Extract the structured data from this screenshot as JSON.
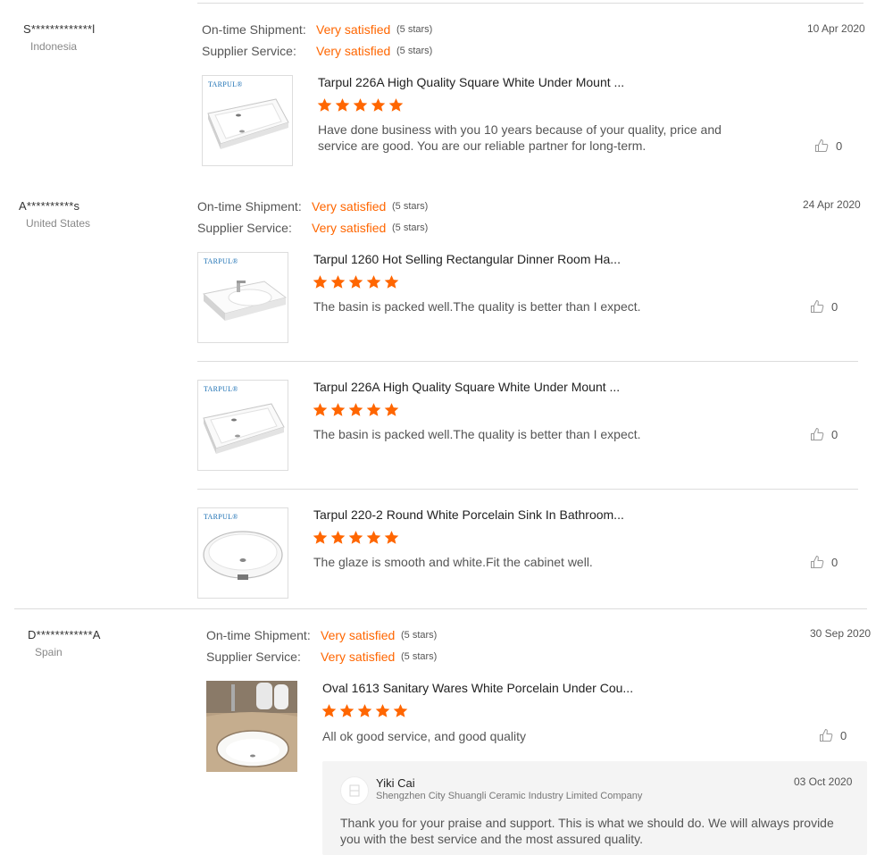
{
  "labels": {
    "ontime": "On-time Shipment:",
    "supplier": "Supplier Service:"
  },
  "colors": {
    "accent": "#ff6600"
  },
  "reviewers": [
    {
      "name": "S*************l",
      "country": "Indonesia",
      "date": "10 Apr 2020",
      "ontime": "Very satisfied",
      "ontime_stars": "(5 stars)",
      "supplier": "Very satisfied",
      "supplier_stars": "(5 stars)",
      "products": [
        {
          "title": "Tarpul 226A High Quality Square White Under Mount ...",
          "brand": "TARPUL®",
          "rating": 5,
          "review": "Have done business with you 10 years because of your quality, price and service are good. You are our reliable partner for long-term.",
          "likes": "0"
        }
      ]
    },
    {
      "name": "A**********s",
      "country": "United States",
      "date": "24 Apr 2020",
      "ontime": "Very satisfied",
      "ontime_stars": "(5 stars)",
      "supplier": "Very satisfied",
      "supplier_stars": "(5 stars)",
      "products": [
        {
          "title": "Tarpul 1260 Hot Selling Rectangular Dinner Room Ha...",
          "brand": "TARPUL®",
          "rating": 5,
          "review": "The basin is packed well.The quality is better than I expect.",
          "likes": "0"
        },
        {
          "title": "Tarpul 226A High Quality Square White Under Mount ...",
          "brand": "TARPUL®",
          "rating": 5,
          "review": "The basin is packed well.The quality is better than I expect.",
          "likes": "0"
        },
        {
          "title": "Tarpul 220-2 Round White Porcelain Sink In Bathroom...",
          "brand": "TARPUL®",
          "rating": 5,
          "review": "The glaze is smooth and white.Fit the cabinet well.",
          "likes": "0"
        }
      ]
    },
    {
      "name": "D************A",
      "country": "Spain",
      "date": "30 Sep 2020",
      "ontime": "Very satisfied",
      "ontime_stars": "(5 stars)",
      "supplier": "Very satisfied",
      "supplier_stars": "(5 stars)",
      "products": [
        {
          "title": "Oval 1613 Sanitary Wares White Porcelain Under Cou...",
          "rating": 5,
          "review": "All ok good service, and good quality",
          "likes": "0"
        }
      ],
      "reply": {
        "name": "Yiki Cai",
        "company": "Shengzhen City Shuangli Ceramic Industry Limited Company",
        "date": "03 Oct 2020",
        "text": "Thank you for your praise and support. This is what we should do. We will always provide you with the best service and the most assured quality."
      }
    }
  ]
}
